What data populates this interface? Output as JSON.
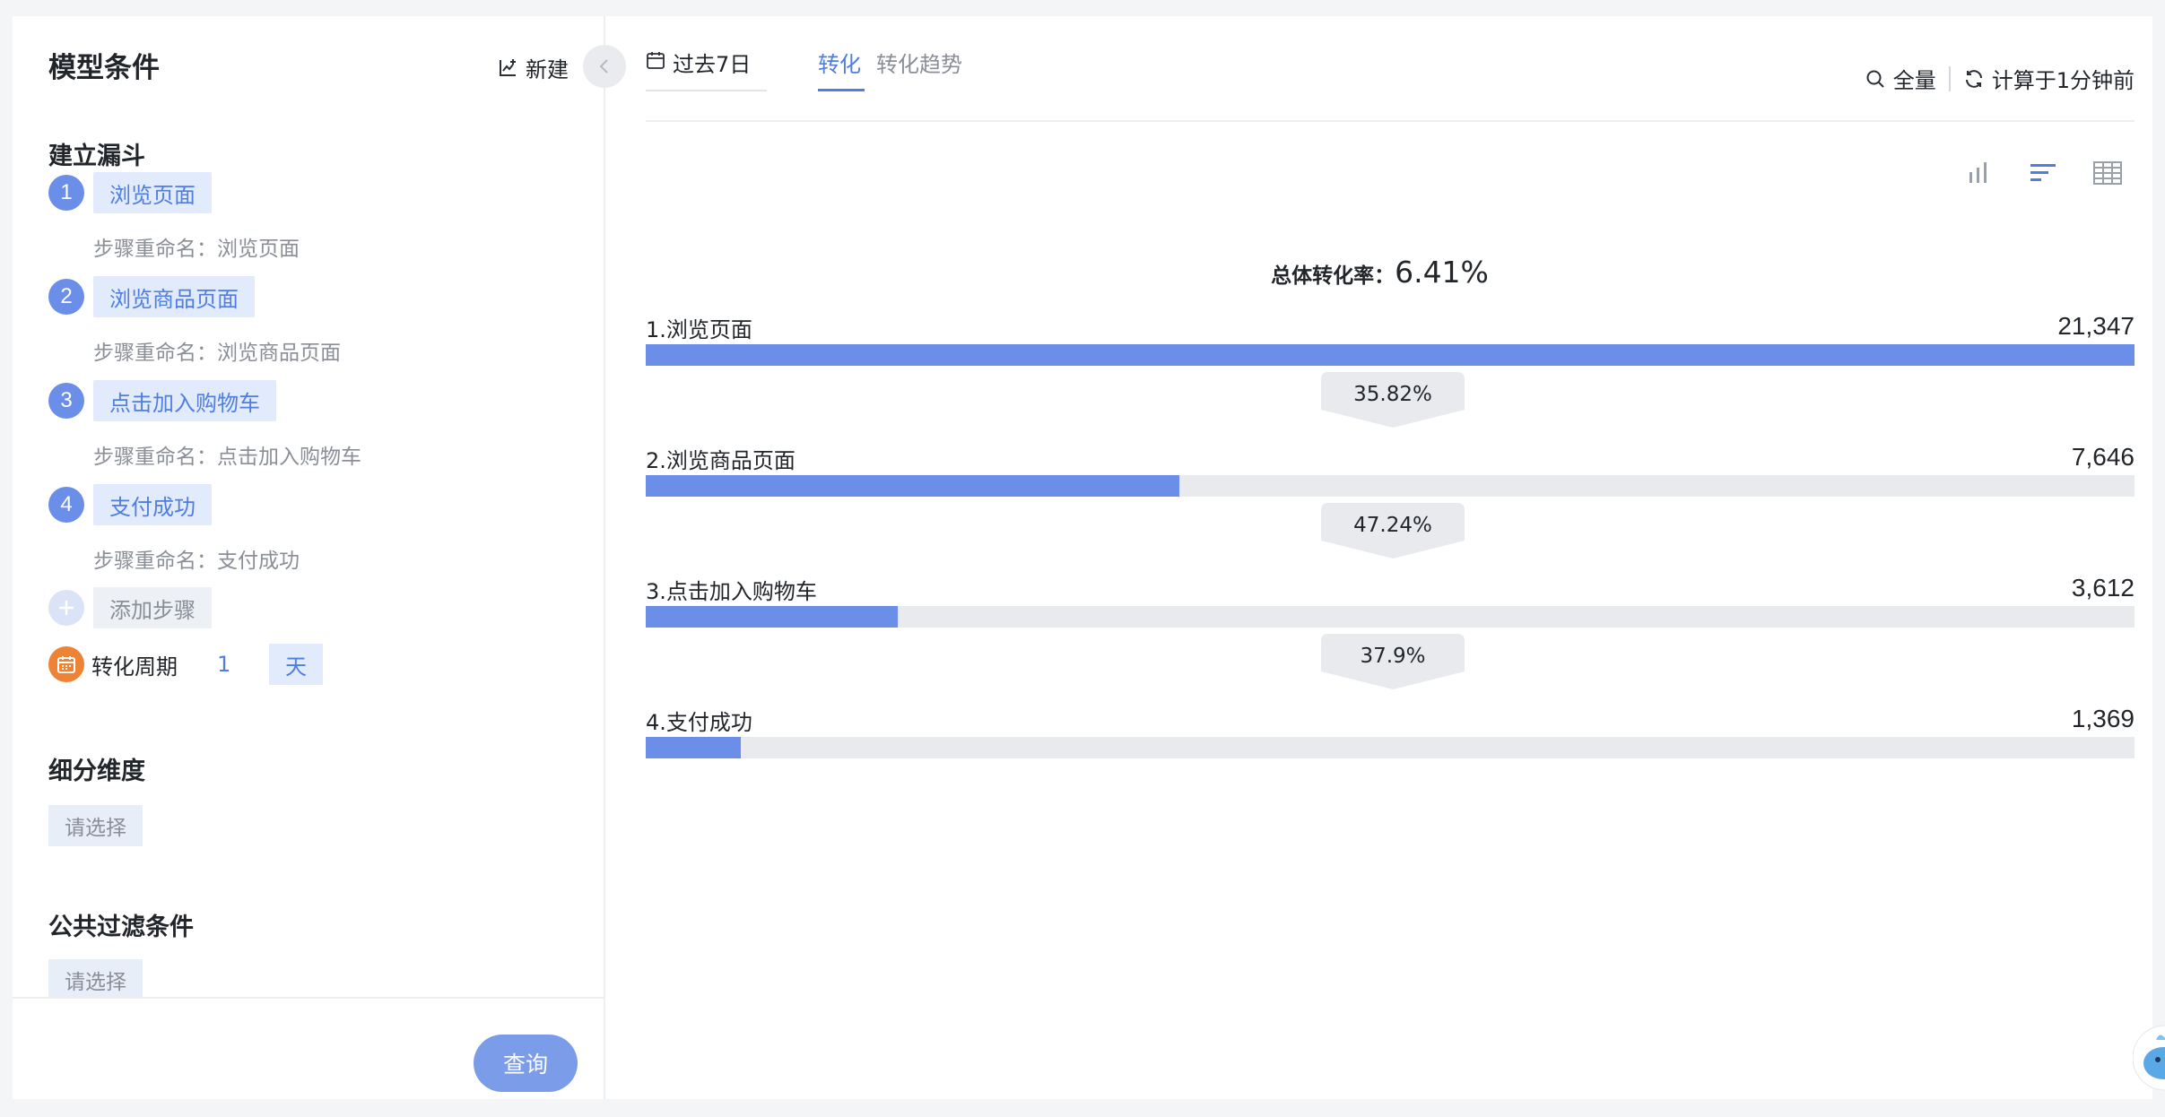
{
  "left_panel": {
    "title": "模型条件",
    "new_label": "新建",
    "funnel_section": "建立漏斗",
    "steps": [
      {
        "num": "1",
        "label": "浏览页面",
        "rename": "步骤重命名：浏览页面"
      },
      {
        "num": "2",
        "label": "浏览商品页面",
        "rename": "步骤重命名：浏览商品页面"
      },
      {
        "num": "3",
        "label": "点击加入购物车",
        "rename": "步骤重命名：点击加入购物车"
      },
      {
        "num": "4",
        "label": "支付成功",
        "rename": "步骤重命名：支付成功"
      }
    ],
    "add_step_label": "添加步骤",
    "period": {
      "label": "转化周期",
      "value": "1",
      "unit": "天"
    },
    "breakdown_section": "细分维度",
    "breakdown_placeholder": "请选择",
    "filter_section": "公共过滤条件",
    "filter_placeholder": "请选择",
    "query_label": "查询"
  },
  "right_panel": {
    "date_range": "过去7日",
    "tabs": [
      {
        "label": "转化",
        "active": true
      },
      {
        "label": "转化趋势",
        "active": false
      }
    ],
    "scope_label": "全量",
    "computed_label": "计算于1分钟前",
    "view_icons": [
      "bar-chart-icon",
      "funnel-bars-icon",
      "table-icon"
    ],
    "overall_label": "总体转化率：",
    "overall_value": "6.41%"
  },
  "chart_data": {
    "type": "bar",
    "orientation": "horizontal-funnel",
    "categories": [
      "1.浏览页面",
      "2.浏览商品页面",
      "3.点击加入购物车",
      "4.支付成功"
    ],
    "values": [
      21347,
      7646,
      3612,
      1369
    ],
    "value_labels": [
      "21,347",
      "7,646",
      "3,612",
      "1,369"
    ],
    "step_conversion_rates": [
      "35.82%",
      "47.24%",
      "37.9%"
    ],
    "overall_conversion_rate": "6.41%",
    "xlim": [
      0,
      21347
    ]
  },
  "colors": {
    "accent": "#4f7de0",
    "bar": "#6b8fe8",
    "track": "#e8eaee",
    "calendar_orange": "#ee8336"
  }
}
